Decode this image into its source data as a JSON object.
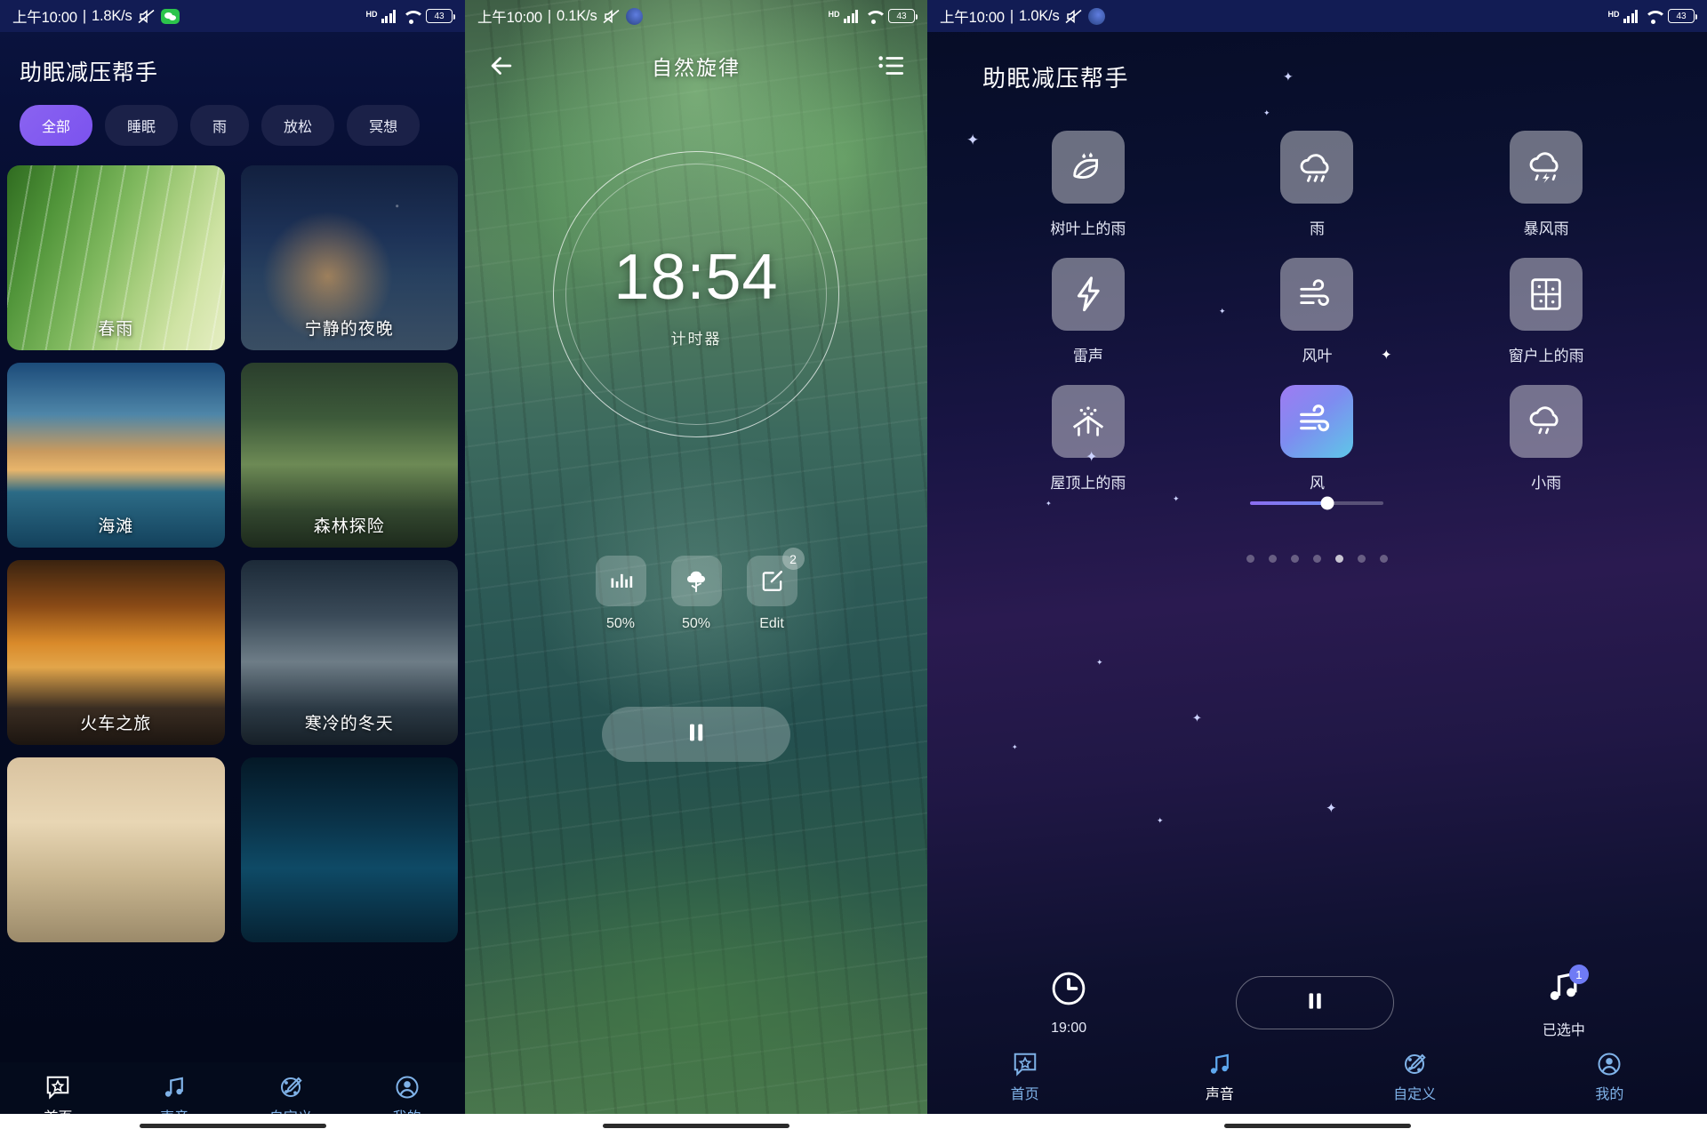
{
  "panel1": {
    "status": {
      "time": "上午10:00",
      "speed": "1.8K/s",
      "battery": "43",
      "network": "HD",
      "icons": [
        "mute-icon",
        "wechat-icon",
        "signal-icon",
        "wifi-icon",
        "battery-icon"
      ]
    },
    "title": "助眠减压帮手",
    "chips": [
      {
        "label": "全部",
        "active": true
      },
      {
        "label": "睡眠",
        "active": false
      },
      {
        "label": "雨",
        "active": false
      },
      {
        "label": "放松",
        "active": false
      },
      {
        "label": "冥想",
        "active": false
      }
    ],
    "cards": [
      {
        "label": "春雨"
      },
      {
        "label": "宁静的夜晚"
      },
      {
        "label": "海滩"
      },
      {
        "label": "森林探险"
      },
      {
        "label": "火车之旅"
      },
      {
        "label": "寒冷的冬天"
      },
      {
        "label": ""
      },
      {
        "label": ""
      }
    ],
    "nav": [
      {
        "label": "首页",
        "icon": "home-star-icon",
        "active": true
      },
      {
        "label": "声音",
        "icon": "music-note-icon",
        "active": false
      },
      {
        "label": "自定义",
        "icon": "customize-pen-icon",
        "active": false
      },
      {
        "label": "我的",
        "icon": "profile-person-icon",
        "active": false
      }
    ]
  },
  "panel2": {
    "status": {
      "time": "上午10:00",
      "speed": "0.1K/s",
      "battery": "43",
      "network": "HD",
      "icons": [
        "mute-icon",
        "moon-icon",
        "signal-icon",
        "wifi-icon",
        "battery-icon"
      ]
    },
    "back_icon": "back-arrow-icon",
    "title": "自然旋律",
    "list_icon": "playlist-icon",
    "timer": {
      "value": "18:54",
      "label": "计时器"
    },
    "controls": [
      {
        "label": "50%",
        "icon": "equalizer-icon",
        "badge": ""
      },
      {
        "label": "50%",
        "icon": "tree-icon",
        "badge": ""
      },
      {
        "label": "Edit",
        "icon": "edit-pencil-icon",
        "badge": "2"
      }
    ],
    "play_icon": "pause-icon"
  },
  "panel3": {
    "status": {
      "time": "上午10:00",
      "speed": "1.0K/s",
      "battery": "43",
      "network": "HD",
      "icons": [
        "mute-icon",
        "moon-icon",
        "signal-icon",
        "wifi-icon",
        "battery-icon"
      ]
    },
    "title": "助眠减压帮手",
    "sounds": [
      {
        "label": "树叶上的雨",
        "icon": "leaf-rain-icon",
        "active": false
      },
      {
        "label": "雨",
        "icon": "rain-cloud-icon",
        "active": false
      },
      {
        "label": "暴风雨",
        "icon": "thunderstorm-icon",
        "active": false
      },
      {
        "label": "雷声",
        "icon": "lightning-icon",
        "active": false
      },
      {
        "label": "风叶",
        "icon": "wind-leaf-icon",
        "active": false
      },
      {
        "label": "窗户上的雨",
        "icon": "window-rain-icon",
        "active": false
      },
      {
        "label": "屋顶上的雨",
        "icon": "roof-rain-icon",
        "active": false
      },
      {
        "label": "风",
        "icon": "wind-icon",
        "active": true,
        "volume": 58
      },
      {
        "label": "小雨",
        "icon": "light-rain-icon",
        "active": false
      }
    ],
    "pager": {
      "count": 7,
      "current": 5
    },
    "player": {
      "timer_label": "19:00",
      "timer_icon": "clock-icon",
      "play_icon": "pause-icon",
      "selected_label": "已选中",
      "selected_icon": "music-note-icon",
      "selected_badge": "1"
    },
    "nav": [
      {
        "label": "首页",
        "icon": "home-star-icon",
        "active": false
      },
      {
        "label": "声音",
        "icon": "music-note-icon",
        "active": true
      },
      {
        "label": "自定义",
        "icon": "customize-pen-icon",
        "active": false
      },
      {
        "label": "我的",
        "icon": "profile-person-icon",
        "active": false
      }
    ]
  }
}
